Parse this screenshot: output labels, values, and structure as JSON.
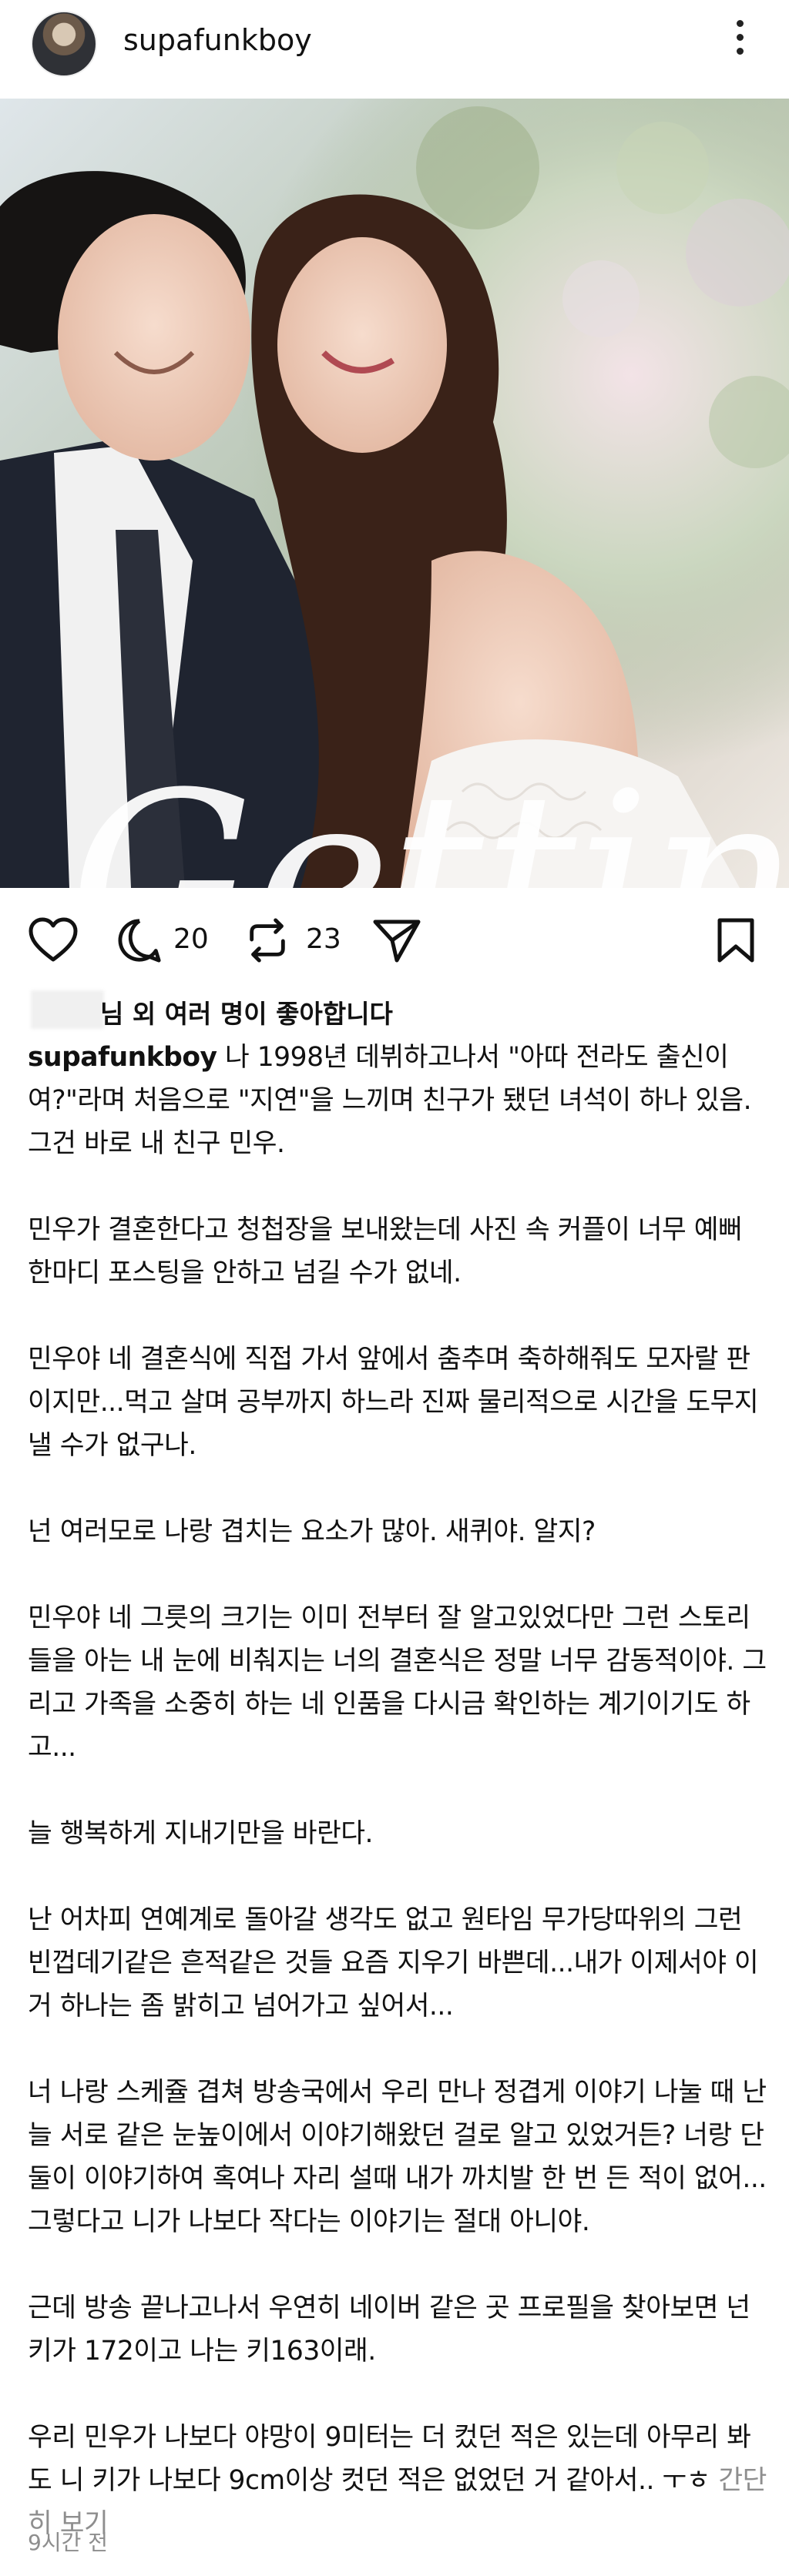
{
  "header": {
    "username": "supafunkboy",
    "avatar_icon": "profile-avatar",
    "more_icon": "more-vertical-icon"
  },
  "photo": {
    "overlay_text": "Getting",
    "description_icon": "wedding-photo"
  },
  "actions": {
    "like_icon": "heart-icon",
    "comment_icon": "comment-icon",
    "comment_count": "20",
    "repost_icon": "repost-icon",
    "repost_count": "23",
    "share_icon": "send-icon",
    "save_icon": "bookmark-icon"
  },
  "likes": {
    "text": "님 외 여러 명이 좋아합니다"
  },
  "caption": {
    "author": "supafunkboy",
    "paragraphs": [
      "나 1998년 데뷔하고나서 \"아따 전라도 출신이여?\"라며 처음으로 \"지연\"을 느끼며 친구가 됐던 녀석이 하나 있음. 그건 바로 내 친구 민우.",
      "민우가 결혼한다고 청첩장을 보내왔는데 사진 속 커플이 너무 예뻐 한마디 포스팅을 안하고 넘길 수가 없네.",
      "민우야 네 결혼식에 직접 가서 앞에서 춤추며 축하해줘도 모자랄 판이지만...먹고 살며 공부까지 하느라 진짜 물리적으로 시간을 도무지 낼 수가 없구나.",
      "넌 여러모로 나랑 겹치는 요소가 많아. 새퀴야. 알지?",
      "민우야 네 그릇의 크기는 이미 전부터 잘 알고있었다만 그런 스토리들을 아는 내 눈에 비춰지는 너의 결혼식은 정말 너무 감동적이야. 그리고 가족을 소중히 하는 네 인품을 다시금 확인하는 계기이기도 하고...",
      "늘 행복하게 지내기만을 바란다.",
      "난 어차피 연예계로 돌아갈 생각도 없고 원타임 무가당따위의 그런 빈껍데기같은 흔적같은 것들  요즘 지우기 바쁜데...내가 이제서야 이거 하나는 좀 밝히고 넘어가고 싶어서...",
      "너 나랑 스케쥴 겹쳐 방송국에서 우리 만나 정겹게 이야기 나눌 때 난 늘 서로 같은 눈높이에서 이야기해왔던 걸로 알고 있었거든? 너랑 단둘이 이야기하여 혹여나 자리 설때  내가 까치발 한 번 든 적이 없어...그렇다고 니가 나보다 작다는 이야기는 절대 아니야.",
      "근데 방송 끝나고나서 우연히 네이버 같은 곳 프로필을 찾아보면 넌 키가 172이고 나는 키163이래.",
      "우리 민우가 나보다 야망이 9미터는 더 컸던 적은 있는데 아무리 봐도 니 키가 나보다 9cm이상 컷던 적은 없었던 거 같아서.. ㅜㅎ"
    ],
    "more_label": "간단히 보기"
  },
  "timestamp": "9시간 전"
}
